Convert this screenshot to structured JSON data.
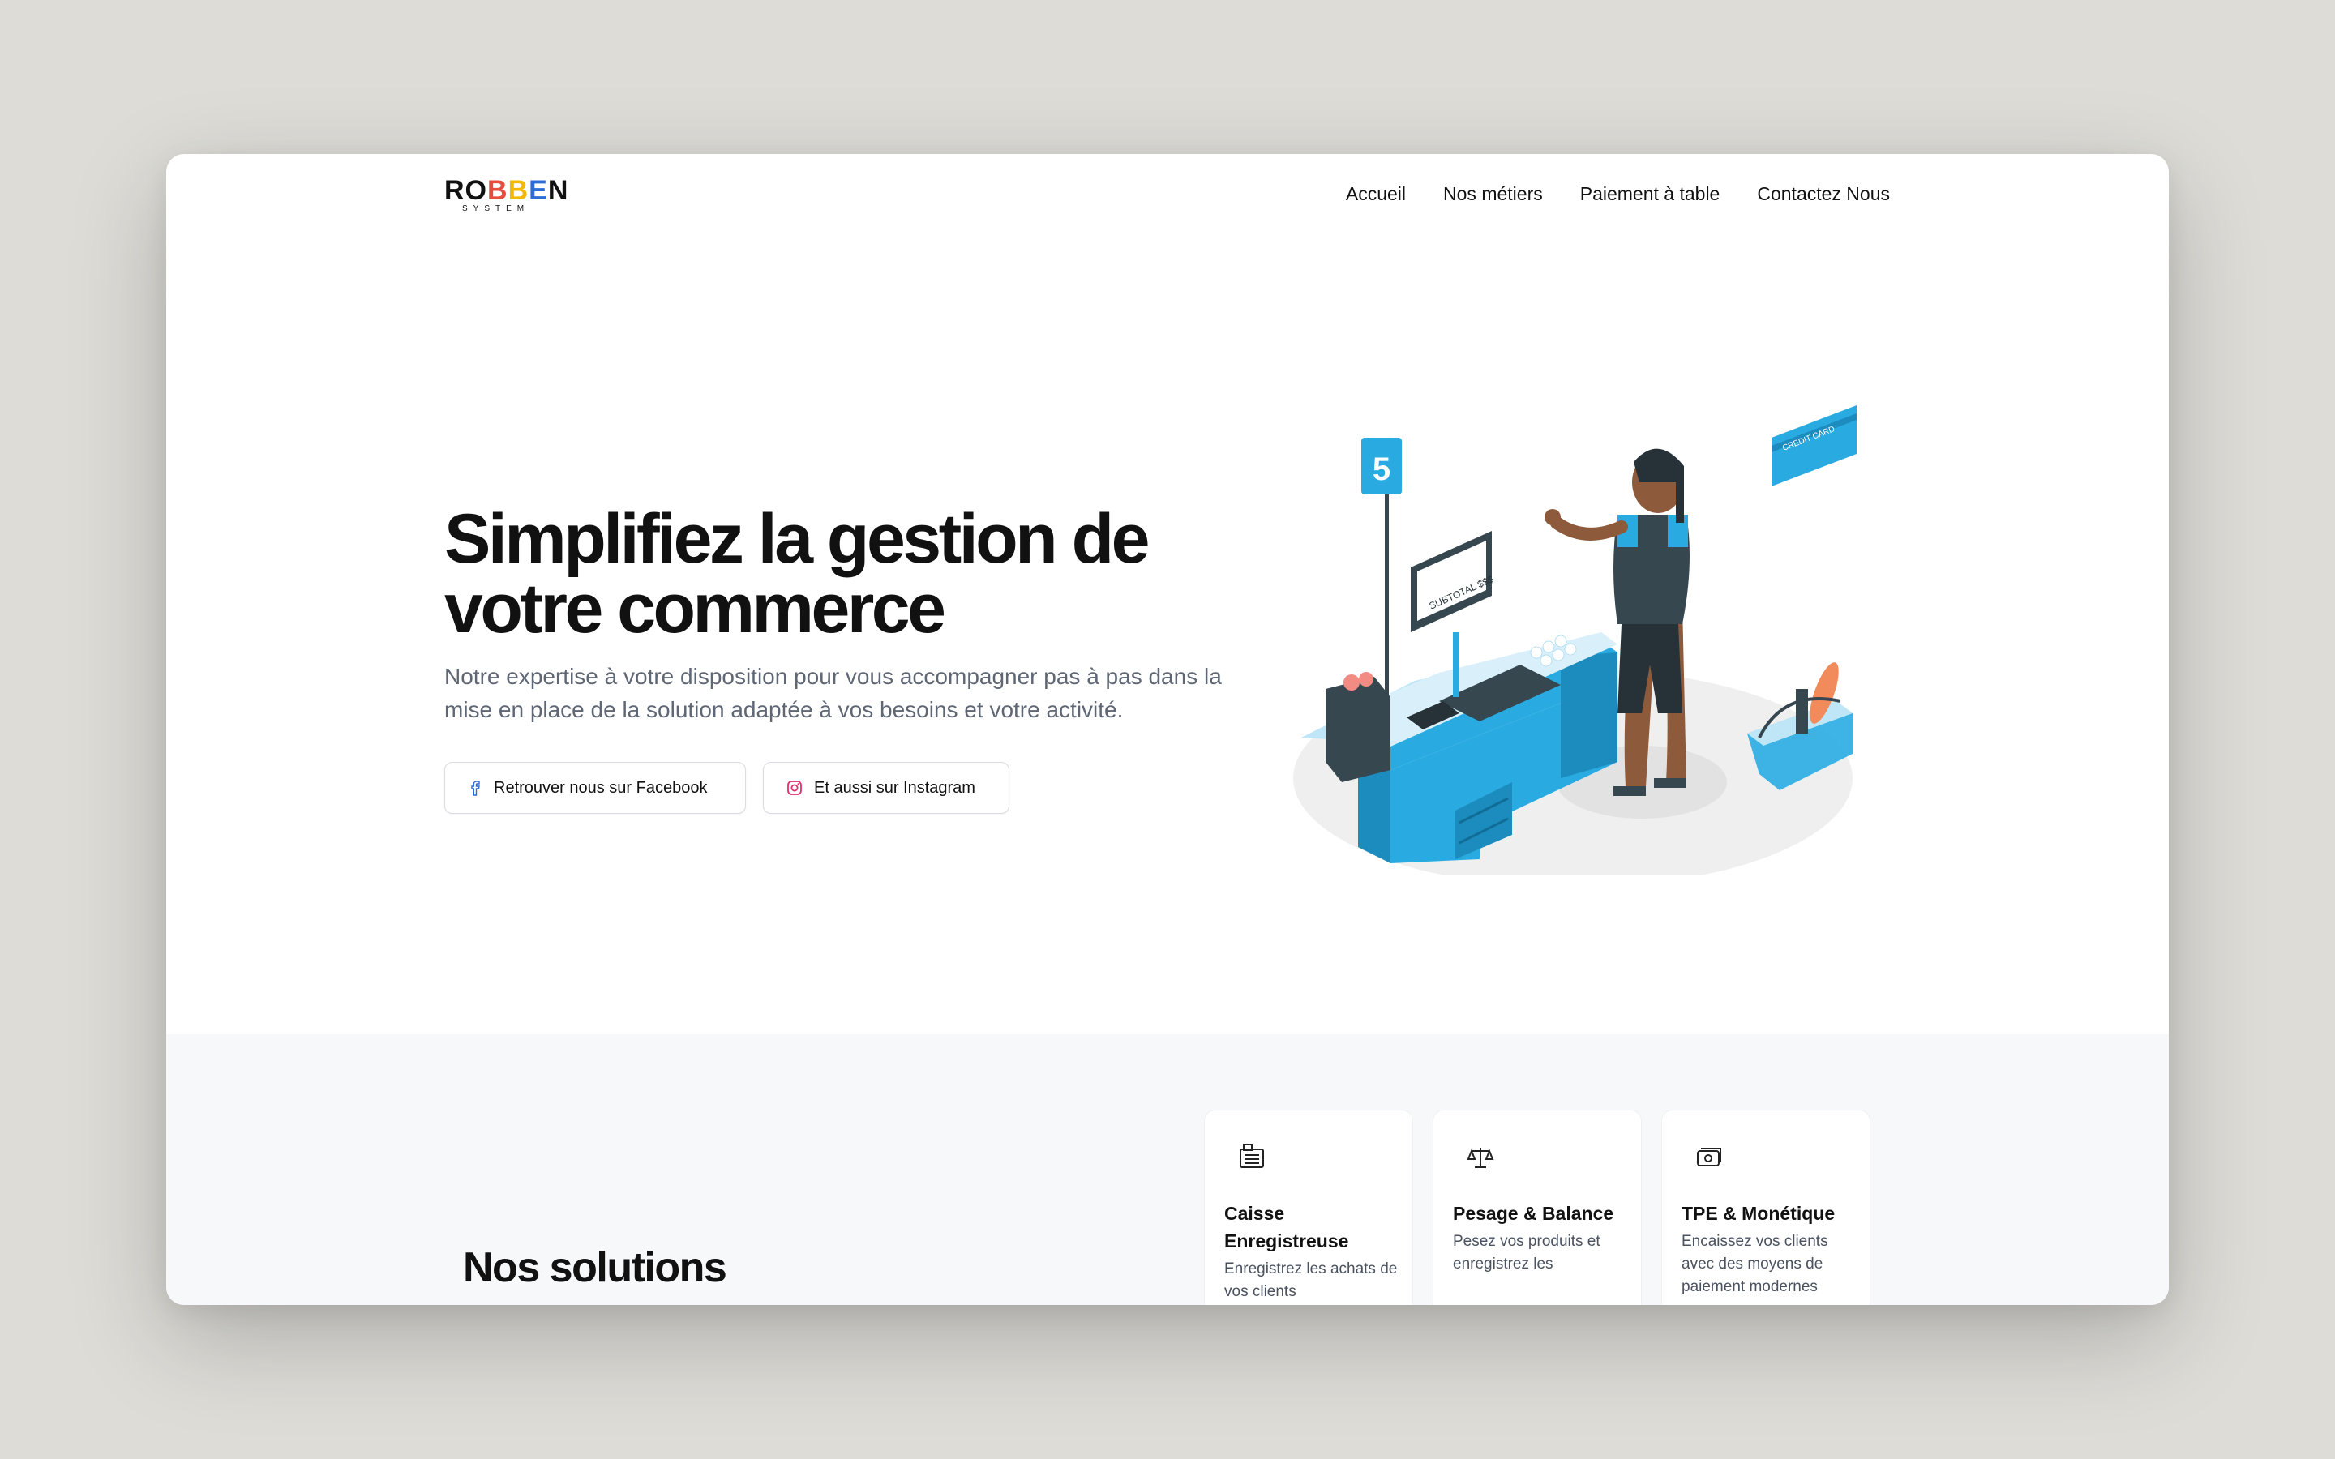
{
  "brand": {
    "logo_text": "ROBBEN",
    "logo_sub": "SYSTEM",
    "colors": {
      "red": "#e74c3c",
      "yellow": "#f5b800",
      "blue": "#2b6cd8"
    }
  },
  "nav": {
    "items": [
      "Accueil",
      "Nos métiers",
      "Paiement à table",
      "Contactez Nous"
    ]
  },
  "hero": {
    "title": "Simplifiez la gestion de votre commerce",
    "subtitle": "Notre expertise à votre disposition pour vous accompagner pas à pas dans la mise en place de la solution adaptée à vos besoins et votre activité.",
    "facebook_button": "Retrouver nous sur Facebook",
    "instagram_button": "Et aussi sur Instagram",
    "illustration": {
      "queue_number": "5",
      "screen_text": "SUBTOTAL $$$",
      "card_text": "CREDIT CARD",
      "accent_color": "#29abe2"
    }
  },
  "solutions": {
    "title": "Nos solutions",
    "cards": [
      {
        "icon": "cash-register-icon",
        "title": "Caisse Enregistreuse",
        "description": "Enregistrez les achats de vos clients"
      },
      {
        "icon": "scale-icon",
        "title": "Pesage & Balance",
        "description": "Pesez vos produits et enregistrez les"
      },
      {
        "icon": "money-icon",
        "title": "TPE & Monétique",
        "description": "Encaissez vos clients avec des moyens de paiement modernes"
      }
    ]
  }
}
